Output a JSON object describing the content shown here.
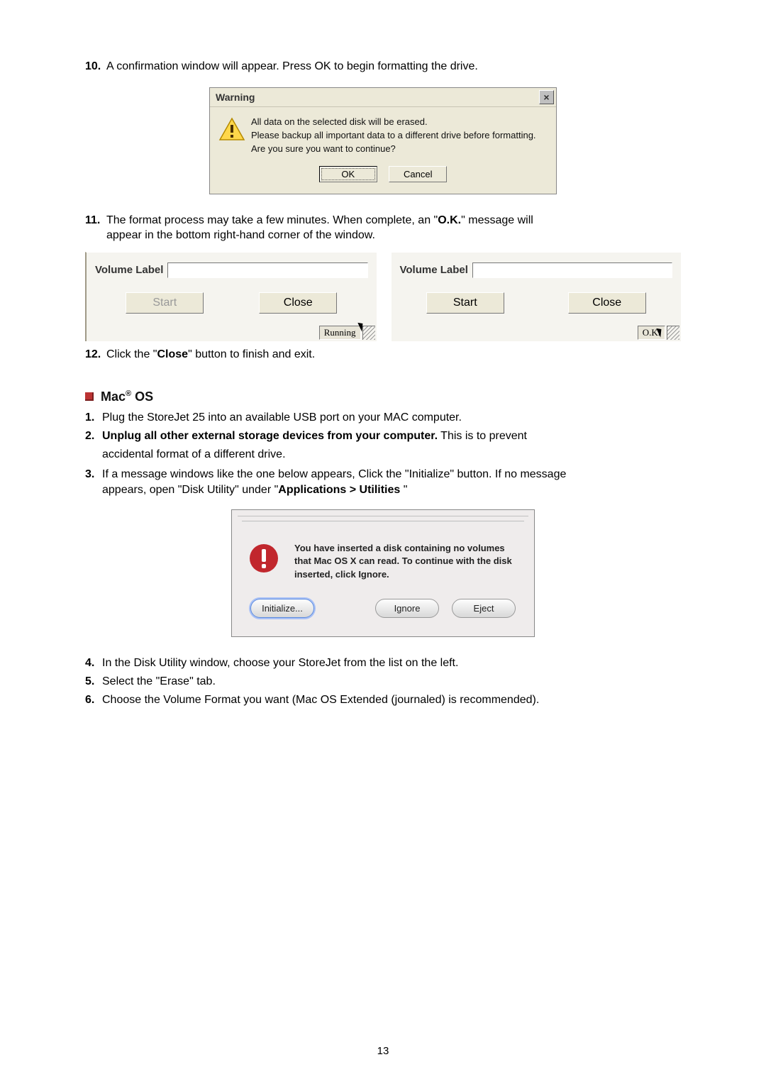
{
  "steps": {
    "s10_num": "10.",
    "s10_text": "A confirmation window will appear. Press OK to begin formatting the drive.",
    "s11_num": "11.",
    "s11_text": "The format process may take a few minutes. When complete, an \"",
    "s11_bold": "O.K.",
    "s11_text2": "\" message will",
    "s11_body": "appear in the bottom right-hand corner of the window.",
    "s12_num": "12.",
    "s12_text_a": "Click the \"",
    "s12_bold": "Close",
    "s12_text_b": "\" button to finish and exit."
  },
  "mac_section": {
    "heading_prefix": "Mac",
    "heading_sup": "®",
    "heading_suffix": " OS",
    "li1_n": "1.",
    "li1_t": "Plug the StoreJet 25 into an available USB port on your MAC computer.",
    "li2_n": "2.",
    "li2_bold": "Unplug all other external storage devices from your computer.",
    "li2_t": " This is to prevent",
    "li2_indent": "accidental format of a different drive.",
    "li3_n": "3.",
    "li3_t_a": "If a message windows like the one below appears, Click the \"Initialize\" button. If no message",
    "li3_t_b": "appears, open \"Disk Utility\" under \"",
    "li3_bold": "Applications > Utilities",
    "li3_t_c": " \"",
    "li4_n": "4.",
    "li4_t": "In the Disk Utility window, choose your StoreJet from the list on the left.",
    "li5_n": "5.",
    "li5_t": "Select the \"Erase\" tab.",
    "li6_n": "6.",
    "li6_t": "Choose the Volume Format you want (Mac OS Extended (journaled) is recommended)."
  },
  "warning_dialog": {
    "title": "Warning",
    "close_x": "×",
    "line1": "All data on the selected disk will be erased.",
    "line2": "Please backup all important data to a different drive before formatting.",
    "line3": "Are you sure you want to continue?",
    "btn_ok": "OK",
    "btn_cancel": "Cancel"
  },
  "panels": {
    "vol_label": "Volume Label",
    "btn_start": "Start",
    "btn_close": "Close",
    "status_running": "Running",
    "status_ok": "O.K."
  },
  "mac_dialog": {
    "text": "You have inserted a disk containing no volumes that Mac OS X can read.  To continue with the disk inserted, click Ignore.",
    "btn_init": "Initialize...",
    "btn_ignore": "Ignore",
    "btn_eject": "Eject"
  },
  "page_number": "13",
  "colors": {
    "accent_red": "#b33",
    "win_bg": "#ece9d8",
    "mac_bg": "#efecec"
  }
}
